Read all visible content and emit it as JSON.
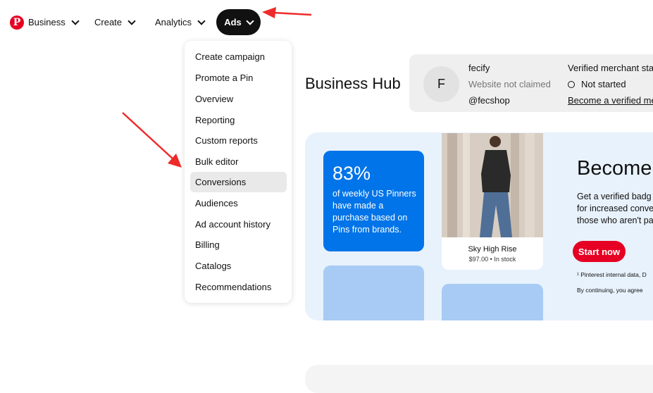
{
  "nav": {
    "business": "Business",
    "create": "Create",
    "analytics": "Analytics",
    "ads": "Ads"
  },
  "ads_menu": {
    "items": [
      "Create campaign",
      "Promote a Pin",
      "Overview",
      "Reporting",
      "Custom reports",
      "Bulk editor",
      "Conversions",
      "Audiences",
      "Ad account history",
      "Billing",
      "Catalogs",
      "Recommendations"
    ],
    "active": "Conversions"
  },
  "hub": {
    "title": "Business Hub",
    "avatar_letter": "F",
    "account_name": "fecify",
    "website_status": "Website not claimed",
    "handle": "@fecshop",
    "merchant_title": "Verified merchant sta",
    "merchant_status": "Not started",
    "merchant_link": "Become a verified me"
  },
  "banner": {
    "stat_value": "83%",
    "stat_text": "of weekly US Pinners have made a purchase based on Pins from brands.",
    "pin_title": "Sky High Rise",
    "pin_price": "$97.00 • In stock",
    "heading": "Become",
    "body_line1": "Get a verified badg",
    "body_line2": "for increased conve",
    "body_line3": "those who aren't pa",
    "cta": "Start now",
    "footnote1": "¹ Pinterest internal data, D",
    "footnote2": "By continuing, you agree"
  },
  "colors": {
    "brand": "#e60023",
    "stat_blue": "#0074e8",
    "banner_bg": "#e8f2fc",
    "arrow": "#ee2b2b"
  }
}
